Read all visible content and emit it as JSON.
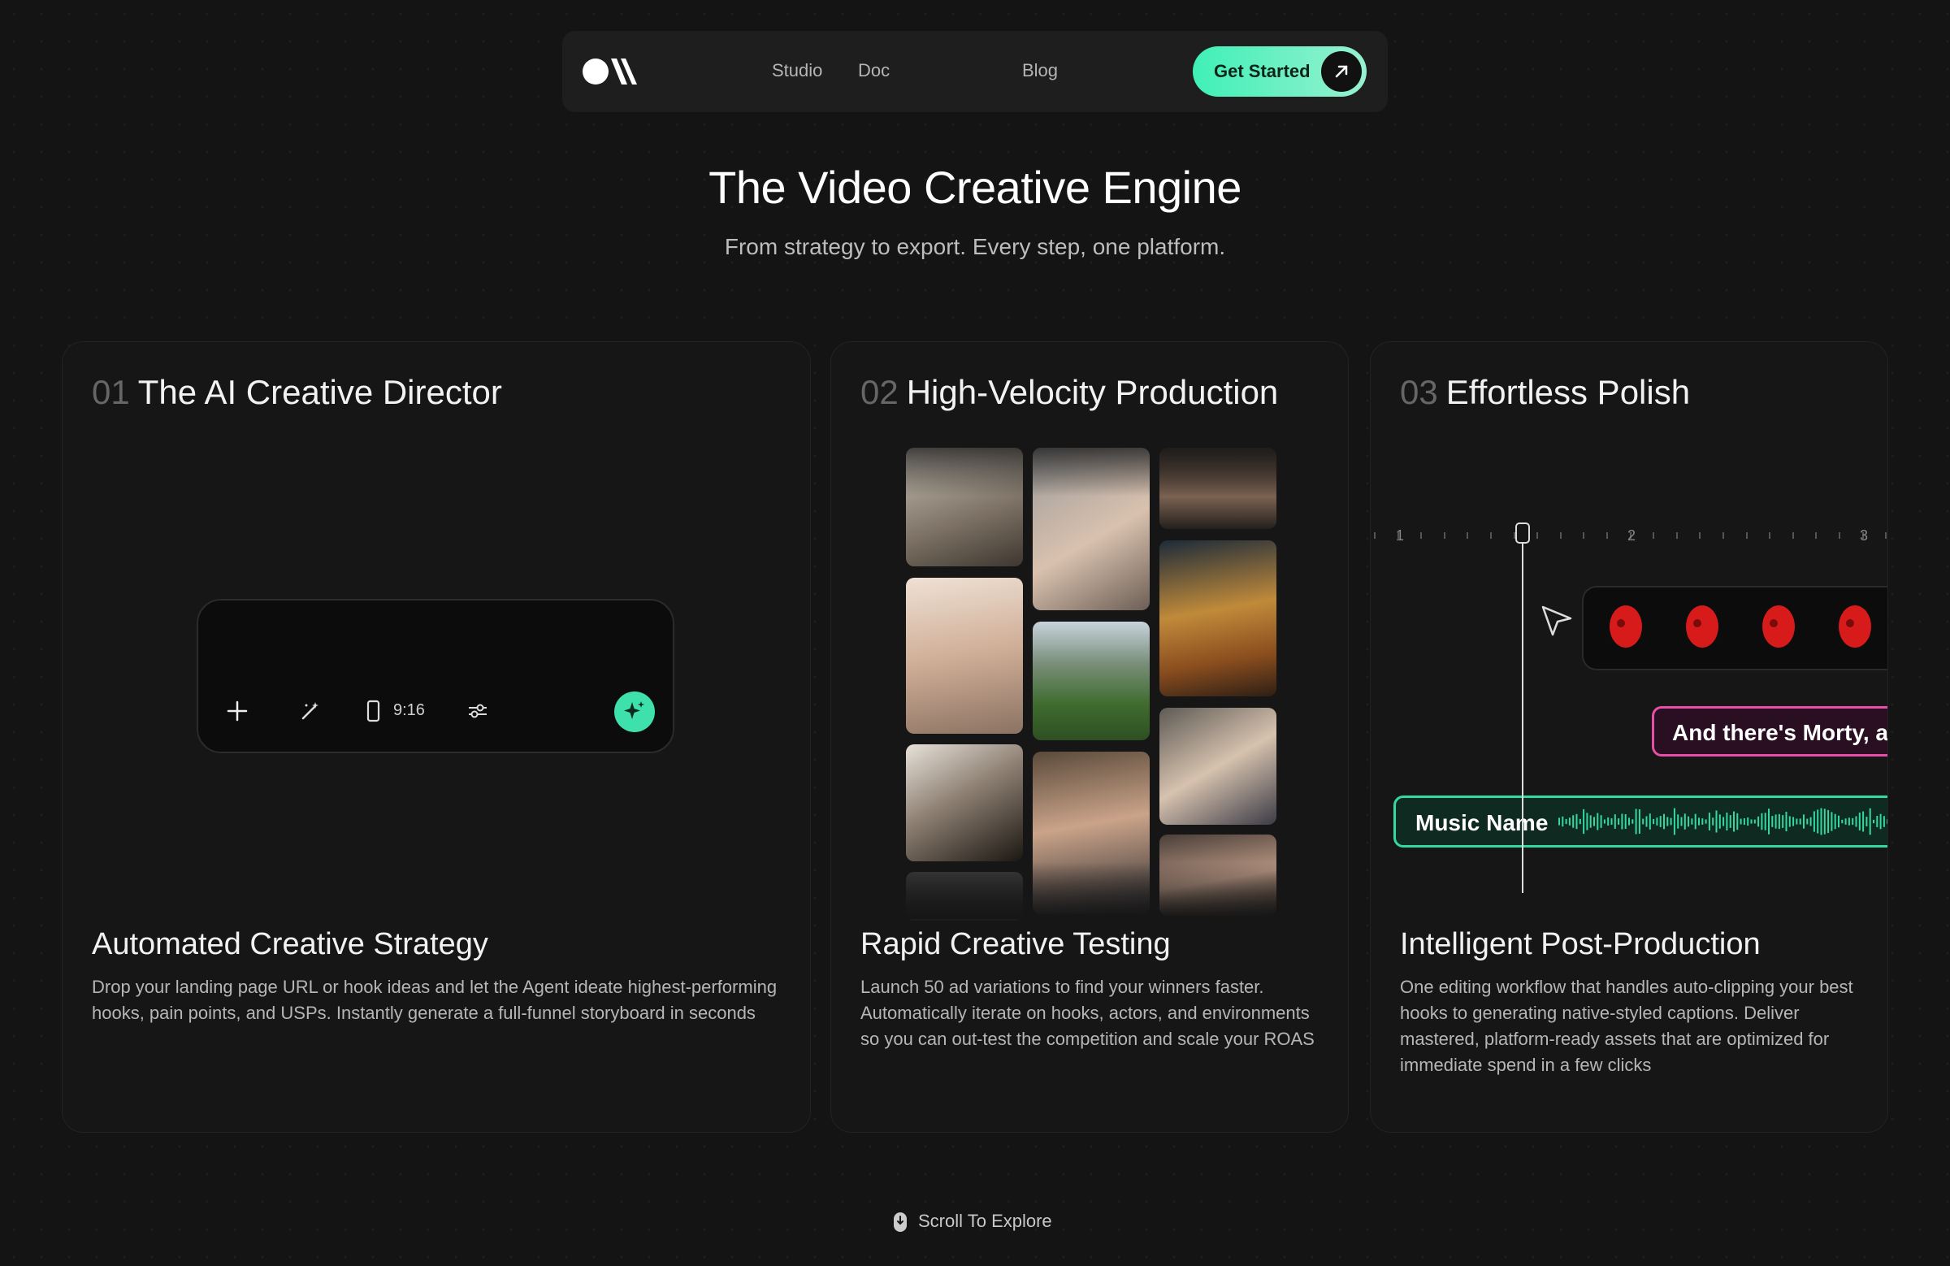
{
  "nav": {
    "links": [
      "Studio",
      "Doc",
      "Blog"
    ],
    "cta_label": "Get Started",
    "cta_icon": "arrow-up-right-icon",
    "accent": "#3ff0b7"
  },
  "hero": {
    "title": "The Video Creative Engine",
    "subtitle": "From strategy to export. Every step, one platform."
  },
  "cards": [
    {
      "number": "01",
      "title": "The AI Creative Director",
      "subheading": "Automated Creative Strategy",
      "description": "Drop your landing page URL or hook ideas and let the Agent ideate highest-performing hooks, pain points, and USPs. Instantly generate a full-funnel storyboard in seconds",
      "prompt": {
        "aspect_ratio": "9:16",
        "icons": [
          "plus-icon",
          "magic-wand-icon",
          "phone-frame-icon",
          "sliders-icon",
          "sparkle-icon"
        ]
      }
    },
    {
      "number": "02",
      "title": "High-Velocity Production",
      "subheading": "Rapid Creative Testing",
      "description": "Launch 50 ad variations to find your winners faster. Automatically iterate on hooks, actors, and environments so you can out-test the competition and scale your ROAS"
    },
    {
      "number": "03",
      "title": "Effortless Polish",
      "subheading": "Intelligent Post-Production",
      "description": "One editing workflow that handles auto-clipping your best hooks to generating native-styled captions. Deliver mastered, platform-ready assets that are optimized for immediate spend in a few clicks",
      "timeline": {
        "ruler_marks": [
          "1",
          "2",
          "3"
        ],
        "caption_text": "And there's Morty, av",
        "music_label": "Music Name",
        "caption_color": "#e84ea8",
        "music_color": "#35d89f"
      }
    }
  ],
  "footer": {
    "scroll_label": "Scroll To Explore"
  }
}
